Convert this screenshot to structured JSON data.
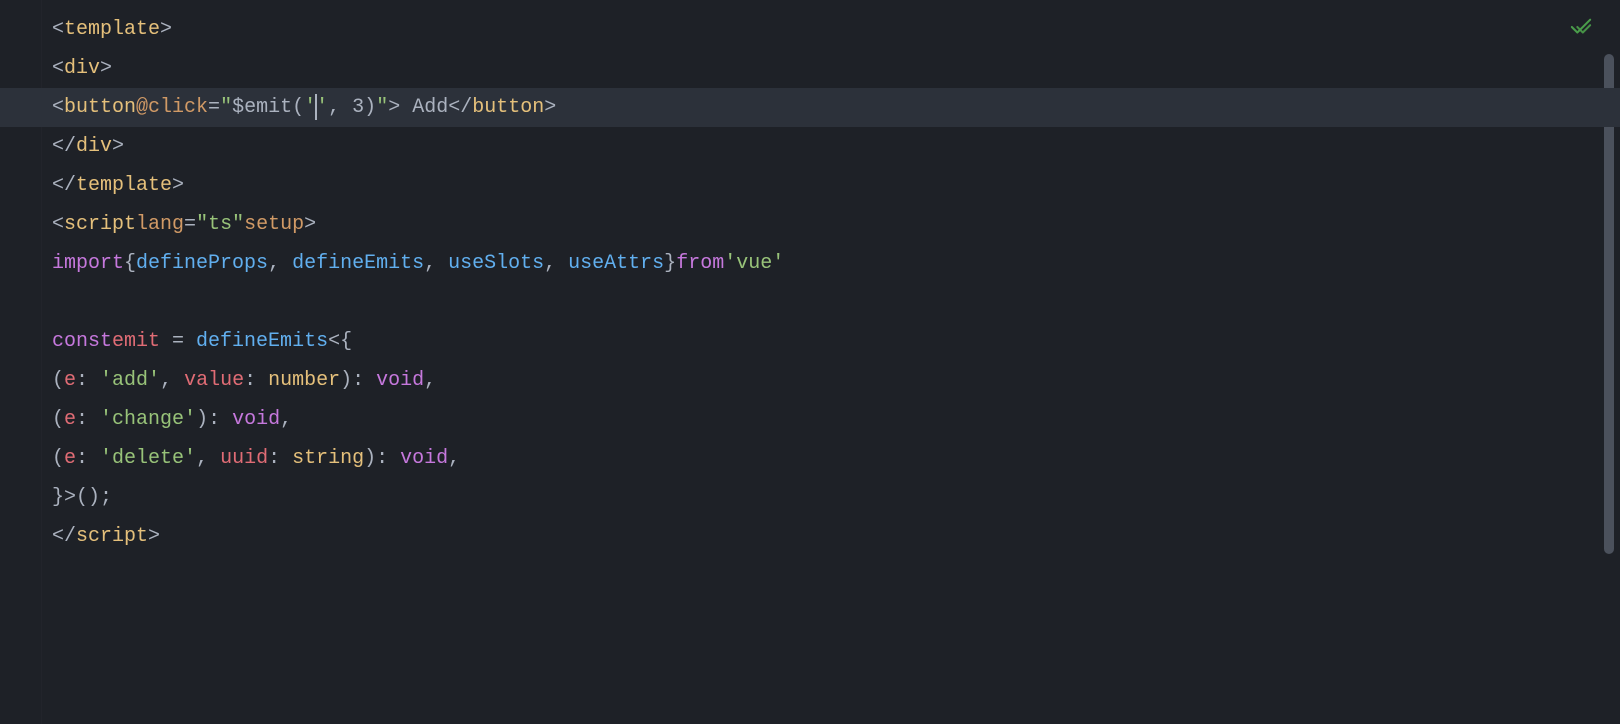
{
  "icons": {
    "check": "check-icon"
  },
  "code": {
    "line1": {
      "tag_template": "template"
    },
    "line2": {
      "tag_div": "div"
    },
    "line3": {
      "tag_button": "button",
      "attr_click": "@click",
      "eq": "=",
      "quote": "\"",
      "emit": "$emit",
      "lparen": "(",
      "sq1": "'",
      "sq2": "'",
      "comma": ", ",
      "arg2": "3",
      "rparen": ")",
      "txt_add": " Add",
      "close_button": "button"
    },
    "line4": {
      "close_div": "div"
    },
    "line5": {
      "close_template": "template"
    },
    "line6": {
      "tag_script": "script",
      "attr_lang": "lang",
      "lang_val": "\"ts\"",
      "attr_setup": "setup"
    },
    "line7": {
      "kw_import": "import",
      "lbrace": "{",
      "i1": "defineProps",
      "sep": ", ",
      "i2": "defineEmits",
      "i3": "useSlots",
      "i4": "useAttrs",
      "rbrace": "}",
      "kw_from": "from",
      "mod": "'vue'"
    },
    "line9": {
      "kw_const": "const",
      "name": "emit",
      "eq": " = ",
      "fn": "defineEmits",
      "lt": "<",
      "lbrace": "{"
    },
    "line10": {
      "lparen": "(",
      "p_e": "e",
      "colon": ": ",
      "v_add": "'add'",
      "comma": ", ",
      "p_value": "value",
      "t_number": "number",
      "rparen": ")",
      "t_void": "void",
      "trail": ","
    },
    "line11": {
      "lparen": "(",
      "p_e": "e",
      "colon": ": ",
      "v_change": "'change'",
      "rparen": ")",
      "t_void": "void",
      "trail": ","
    },
    "line12": {
      "lparen": "(",
      "p_e": "e",
      "colon": ": ",
      "v_delete": "'delete'",
      "comma": ", ",
      "p_uuid": "uuid",
      "t_string": "string",
      "rparen": ")",
      "t_void": "void",
      "trail": ","
    },
    "line13": {
      "close": "}>();"
    },
    "line14": {
      "close_script": "script"
    }
  }
}
